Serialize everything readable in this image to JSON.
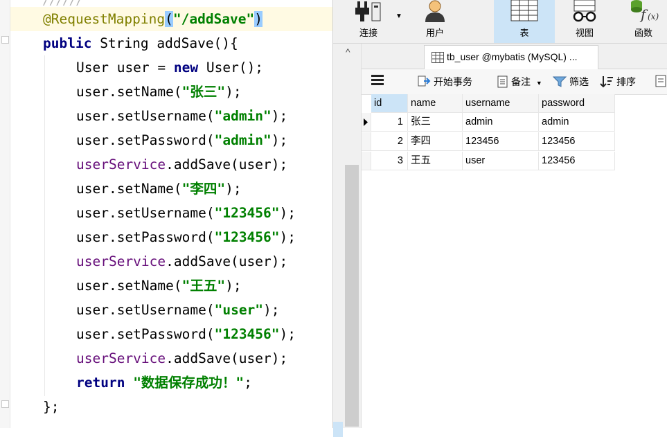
{
  "editor": {
    "top_fragment": "//////",
    "lines": [
      {
        "annotation": "@RequestMapping",
        "paren_open": "(",
        "string": "\"/addSave\"",
        "paren_close": ")"
      },
      {
        "kw": "public",
        "rest": " String addSave(){"
      },
      {
        "pre": "User user = ",
        "kw": "new",
        "post": " User();"
      },
      {
        "pre": "user.setName(",
        "string": "\"张三\"",
        "post": ");"
      },
      {
        "pre": "user.setUsername(",
        "string": "\"admin\"",
        "post": ");"
      },
      {
        "pre": "user.setPassword(",
        "string": "\"admin\"",
        "post": ");"
      },
      {
        "field": "userService",
        "post": ".addSave(user);"
      },
      {
        "pre": "user.setName(",
        "string": "\"李四\"",
        "post": ");"
      },
      {
        "pre": "user.setUsername(",
        "string": "\"123456\"",
        "post": ");"
      },
      {
        "pre": "user.setPassword(",
        "string": "\"123456\"",
        "post": ");"
      },
      {
        "field": "userService",
        "post": ".addSave(user);"
      },
      {
        "pre": "user.setName(",
        "string": "\"王五\"",
        "post": ");"
      },
      {
        "pre": "user.setUsername(",
        "string": "\"user\"",
        "post": ");"
      },
      {
        "pre": "user.setPassword(",
        "string": "\"123456\"",
        "post": ");"
      },
      {
        "field": "userService",
        "post": ".addSave(user);"
      },
      {
        "kw": "return",
        "string": " \"数据保存成功！\"",
        "post": ";"
      },
      {
        "pre": "};"
      }
    ]
  },
  "toolbar": {
    "connect": "连接",
    "user": "用户",
    "table": "表",
    "view": "视图",
    "function": "函数"
  },
  "tab": {
    "title": "tb_user @mybatis (MySQL) ..."
  },
  "grid_toolbar": {
    "menu_icon": "hamburger-icon",
    "begin_transaction": "开始事务",
    "memo": "备注",
    "filter": "筛选",
    "sort": "排序"
  },
  "table": {
    "columns": [
      "id",
      "name",
      "username",
      "password"
    ],
    "rows": [
      {
        "id": "1",
        "name": "张三",
        "username": "admin",
        "password": "admin"
      },
      {
        "id": "2",
        "name": "李四",
        "username": "123456",
        "password": "123456"
      },
      {
        "id": "3",
        "name": "王五",
        "username": "user",
        "password": "123456"
      }
    ]
  },
  "colors": {
    "annotation": "#808000",
    "keyword": "#000080",
    "string": "#008000",
    "field": "#660e7a",
    "selection": "#cce4f7"
  }
}
